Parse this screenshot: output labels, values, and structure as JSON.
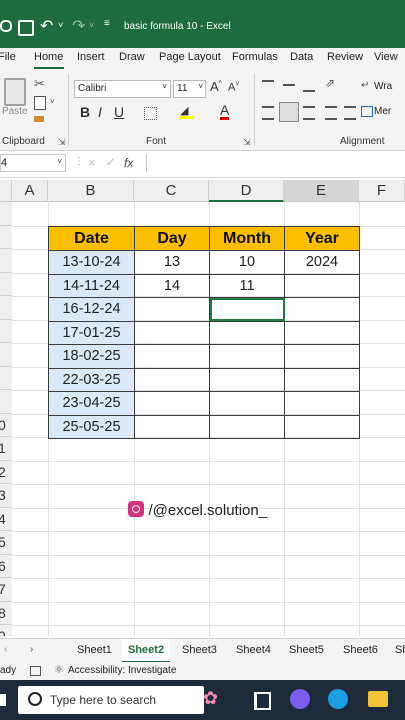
{
  "titlebar": {
    "title": "basic formula 10  -  Excel"
  },
  "ribbon_tabs": [
    "File",
    "Home",
    "Insert",
    "Draw",
    "Page Layout",
    "Formulas",
    "Data",
    "Review",
    "View"
  ],
  "ribbon": {
    "paste_label": "Paste",
    "clipboard_label": "Clipboard",
    "font_label": "Font",
    "alignment_label": "Alignment",
    "font_name": "Calibri",
    "font_size": "11",
    "wrap_label": "Wra",
    "merge_label": "Mer"
  },
  "formula_bar": {
    "name_box": "4",
    "fx": "fx",
    "formula": ""
  },
  "columns": [
    "A",
    "B",
    "C",
    "D",
    "E",
    "F"
  ],
  "rows": [
    "",
    "",
    "",
    "",
    "",
    "",
    "",
    "",
    "",
    "0",
    "1",
    "2",
    "3",
    "4",
    "5",
    "6",
    "7",
    "8",
    "9"
  ],
  "table": {
    "headers": [
      "Date",
      "Day",
      "Month",
      "Year"
    ],
    "rows": [
      [
        "13-10-24",
        "13",
        "10",
        "2024"
      ],
      [
        "14-11-24",
        "14",
        "11",
        ""
      ],
      [
        "16-12-24",
        "",
        "",
        ""
      ],
      [
        "17-01-25",
        "",
        "",
        ""
      ],
      [
        "18-02-25",
        "",
        "",
        ""
      ],
      [
        "22-03-25",
        "",
        "",
        ""
      ],
      [
        "23-04-25",
        "",
        "",
        ""
      ],
      [
        "25-05-25",
        "",
        "",
        ""
      ]
    ]
  },
  "watermark": "/@excel.solution_",
  "sheets": [
    "Sheet1",
    "Sheet2",
    "Sheet3",
    "Sheet4",
    "Sheet5",
    "Sheet6",
    "Sh"
  ],
  "active_sheet": "Sheet2",
  "status": {
    "ready": "ady",
    "accessibility": "Accessibility: Investigate"
  },
  "taskbar": {
    "search_placeholder": "Type here to search"
  },
  "colors": {
    "excel_green": "#1d6b3f",
    "header_fill": "#fcbf00",
    "date_fill": "#dbe9f6"
  }
}
